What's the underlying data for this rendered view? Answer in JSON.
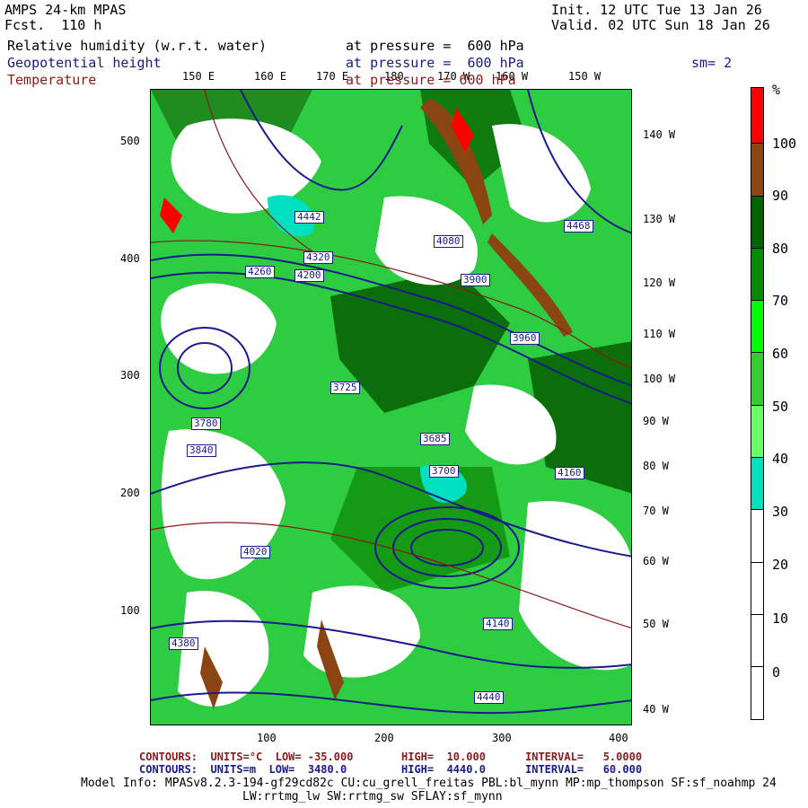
{
  "header": {
    "model": "AMPS 24-km MPAS",
    "forecast": "Fcst.  110 h",
    "init": "Init. 12 UTC Tue 13 Jan 26",
    "valid": "Valid. 02 UTC Sun 18 Jan 26",
    "fields": [
      {
        "name": "Relative humidity (w.r.t. water)",
        "level": "at pressure =  600 hPa",
        "color": "#000000"
      },
      {
        "name": "Geopotential height",
        "level": "at pressure =  600 hPa",
        "color": "#1a1a8c"
      },
      {
        "name": "Temperature",
        "level": "at pressure = 600 hPa",
        "color": "#8b1a1a"
      }
    ],
    "smoothing": "sm= 2"
  },
  "axes": {
    "left_ticks": [
      "500",
      "400",
      "300",
      "200",
      "100"
    ],
    "bottom_ticks": [
      "100",
      "200",
      "300",
      "400"
    ],
    "top_lon": [
      "150 E",
      "160 E",
      "170 E",
      "180",
      "170 W",
      "160 W",
      "150 W"
    ],
    "right_lon": [
      "140 W",
      "130 W",
      "120 W",
      "110 W",
      "100 W",
      "90 W",
      "80 W",
      "70 W",
      "60 W",
      "50 W",
      "40 W"
    ]
  },
  "colorbar": {
    "unit": "%",
    "labels": [
      "100",
      "90",
      "80",
      "70",
      "60",
      "50",
      "40",
      "30",
      "20",
      "10",
      "0"
    ],
    "colors": [
      "#ff0000",
      "#8b4513",
      "#006400",
      "#008c00",
      "#00ff00",
      "#33cc33",
      "#66ff66",
      "#00e0c0",
      "#ffffff",
      "#ffffff",
      "#ffffff",
      "#ffffff"
    ]
  },
  "contour_labels": [
    "4200",
    "4080",
    "4260",
    "4320",
    "4442",
    "3960",
    "3900",
    "3840",
    "3780",
    "4140",
    "4020",
    "4380",
    "4440",
    "3725",
    "3685",
    "3700",
    "4160",
    "4468"
  ],
  "footer": {
    "line1_a": "CONTOURS:  UNITS=°C  LOW= -35.000",
    "line1_b": "HIGH=  10.000",
    "line1_c": "INTERVAL=   5.0000",
    "line2_a": "CONTOURS:  UNITS=m  LOW=  3480.0",
    "line2_b": "HIGH=  4440.0",
    "line2_c": "INTERVAL=   60.000",
    "model_info": "Model Info: MPASv8.2.3-194-gf29cd82c CU:cu_grell_freitas PBL:bl_mynn MP:mp_thompson SF:sf_noahmp 24",
    "model_info2": "LW:rrtmg_lw SW:rrtmg_sw SFLAY:sf_mynn"
  }
}
